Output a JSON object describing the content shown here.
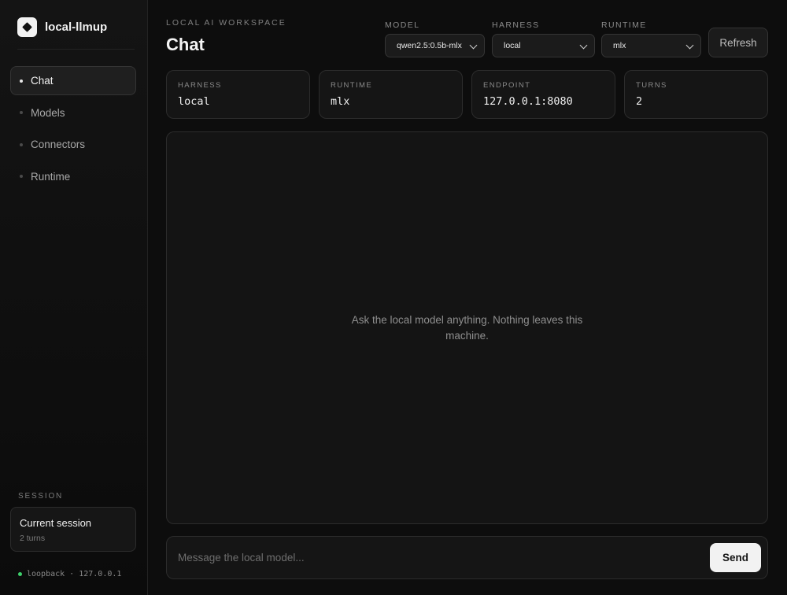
{
  "app": {
    "name": "local-llmup"
  },
  "sidebar": {
    "items": [
      {
        "label": "Chat",
        "active": true
      },
      {
        "label": "Models",
        "active": false
      },
      {
        "label": "Connectors",
        "active": false
      },
      {
        "label": "Runtime",
        "active": false
      }
    ],
    "session_label": "SESSION",
    "session": {
      "title": "Current session",
      "subtitle": "2 turns"
    },
    "status": {
      "text": "loopback · 127.0.0.1",
      "color": "#3ecf6b"
    }
  },
  "header": {
    "eyebrow": "LOCAL AI WORKSPACE",
    "title": "Chat",
    "model": {
      "label": "MODEL",
      "value": "qwen2.5:0.5b-mlx"
    },
    "harness": {
      "label": "HARNESS",
      "value": "local"
    },
    "runtime": {
      "label": "RUNTIME",
      "value": "mlx"
    },
    "refresh_label": "Refresh"
  },
  "stats": [
    {
      "label": "HARNESS",
      "value": "local"
    },
    {
      "label": "RUNTIME",
      "value": "mlx"
    },
    {
      "label": "ENDPOINT",
      "value": "127.0.0.1:8080"
    },
    {
      "label": "TURNS",
      "value": "2"
    }
  ],
  "chat": {
    "empty_message": "Ask the local model anything. Nothing leaves this machine."
  },
  "composer": {
    "placeholder": "Message the local model...",
    "value": "",
    "send_label": "Send"
  }
}
